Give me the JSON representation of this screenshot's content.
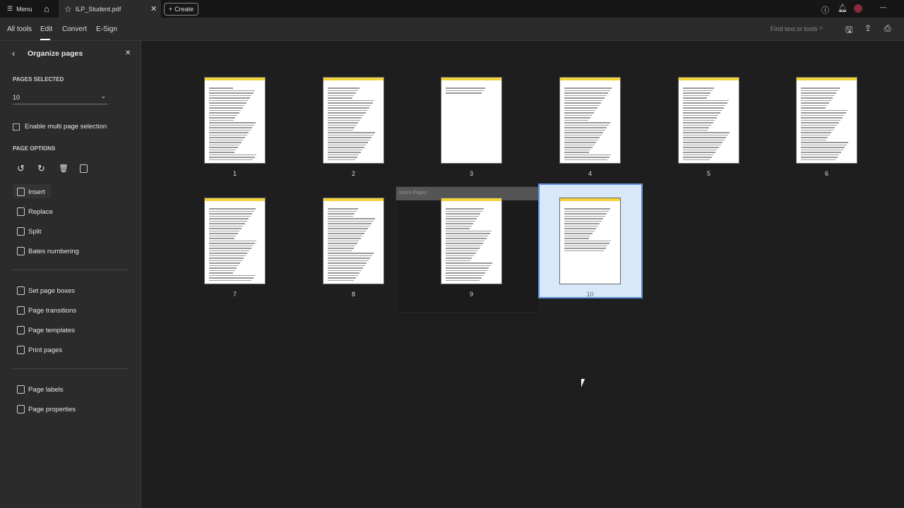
{
  "topbar": {
    "menu": "Menu",
    "tab_title": "ILP_Student.pdf",
    "create": "Create"
  },
  "toolbar": {
    "tabs": [
      "All tools",
      "Edit",
      "Convert",
      "E-Sign"
    ],
    "active": "Edit",
    "search_placeholder": "Find text or tools"
  },
  "sidebar": {
    "title": "Organize pages",
    "pages_selected_label": "PAGES SELECTED",
    "pages_selected_value": "10",
    "multi_select": "Enable multi page selection",
    "page_options_label": "PAGE OPTIONS",
    "items1": [
      "Insert",
      "Replace",
      "Split",
      "Bates numbering"
    ],
    "items2": [
      "Set page boxes",
      "Page transitions",
      "Page templates",
      "Print pages"
    ],
    "items3": [
      "Page labels",
      "Page properties"
    ]
  },
  "popup": {
    "title": "Insert Pages"
  },
  "pages": [
    "1",
    "2",
    "3",
    "4",
    "5",
    "6",
    "7",
    "8",
    "9",
    "10"
  ],
  "selected_page": "10",
  "colors": {
    "accent": "#5d8fd6",
    "header_yellow": "#f2d43a"
  }
}
